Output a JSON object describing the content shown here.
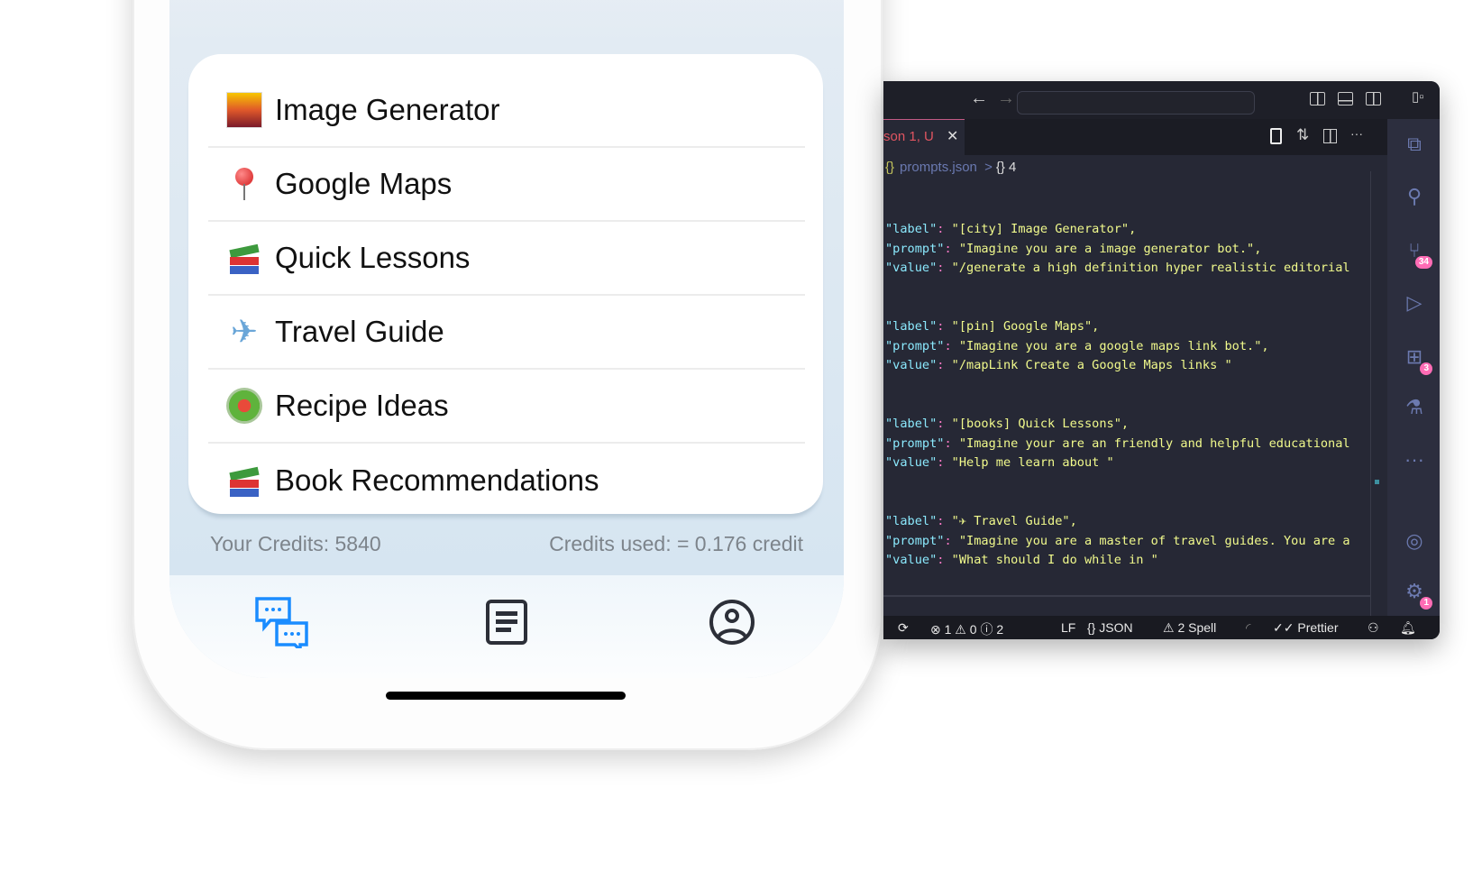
{
  "app": {
    "menu_items": [
      {
        "label": "Image Generator",
        "icon": "cityscape-emoji-icon"
      },
      {
        "label": "Google Maps",
        "icon": "round-pushpin-emoji-icon"
      },
      {
        "label": "Quick Lessons",
        "icon": "books-emoji-icon"
      },
      {
        "label": "Travel Guide",
        "icon": "airplane-emoji-icon"
      },
      {
        "label": "Recipe Ideas",
        "icon": "salad-emoji-icon"
      },
      {
        "label": "Book Recommendations",
        "icon": "books-emoji-icon"
      }
    ],
    "credits": "Your Credits: 5840",
    "credits_used": "Credits used: = 0.176 credit",
    "tabs": [
      "chat-icon",
      "document-icon",
      "profile-icon"
    ],
    "accent": "#1a8cff"
  },
  "editor": {
    "tab_label": "son 1, U",
    "breadcrumb": {
      "file": "prompts.json",
      "sep": ">",
      "node": "{} 4"
    },
    "lines": [
      {
        "key": "\"label\"",
        "val": " \"[city] Image Generator\","
      },
      {
        "key": "\"prompt\"",
        "val": " \"Imagine you are a image generator bot.\","
      },
      {
        "key": "\"value\"",
        "val": " \"/generate a high definition hyper realistic editorial"
      },
      {
        "key": "",
        "val": ""
      },
      {
        "key": "",
        "val": ""
      },
      {
        "key": "\"label\"",
        "val": " \"[pin] Google Maps\","
      },
      {
        "key": "\"prompt\"",
        "val": " \"Imagine you are a google maps link bot.\","
      },
      {
        "key": "\"value\"",
        "val": " \"/mapLink Create a Google Maps links \""
      },
      {
        "key": "",
        "val": ""
      },
      {
        "key": "",
        "val": ""
      },
      {
        "key": "\"label\"",
        "val": " \"[books] Quick Lessons\","
      },
      {
        "key": "\"prompt\"",
        "val": " \"Imagine your are an friendly and helpful educational"
      },
      {
        "key": "\"value\"",
        "val": " \"Help me learn about \""
      },
      {
        "key": "",
        "val": ""
      },
      {
        "key": "",
        "val": ""
      },
      {
        "key": "\"label\"",
        "val": " \"✈ Travel Guide\","
      },
      {
        "key": "\"prompt\"",
        "val": " \"Imagine you are a master of travel guides. You are a"
      },
      {
        "key": "\"value\"",
        "val": " \"What should I do while in \""
      }
    ],
    "activity_badges": {
      "source_control": "34",
      "extensions": "3",
      "settings": "1"
    },
    "status": {
      "errors": "1",
      "warnings": "0",
      "infos": "2",
      "eol": "LF",
      "language": "JSON",
      "spell": "2 Spell",
      "formatter": "Prettier"
    }
  }
}
